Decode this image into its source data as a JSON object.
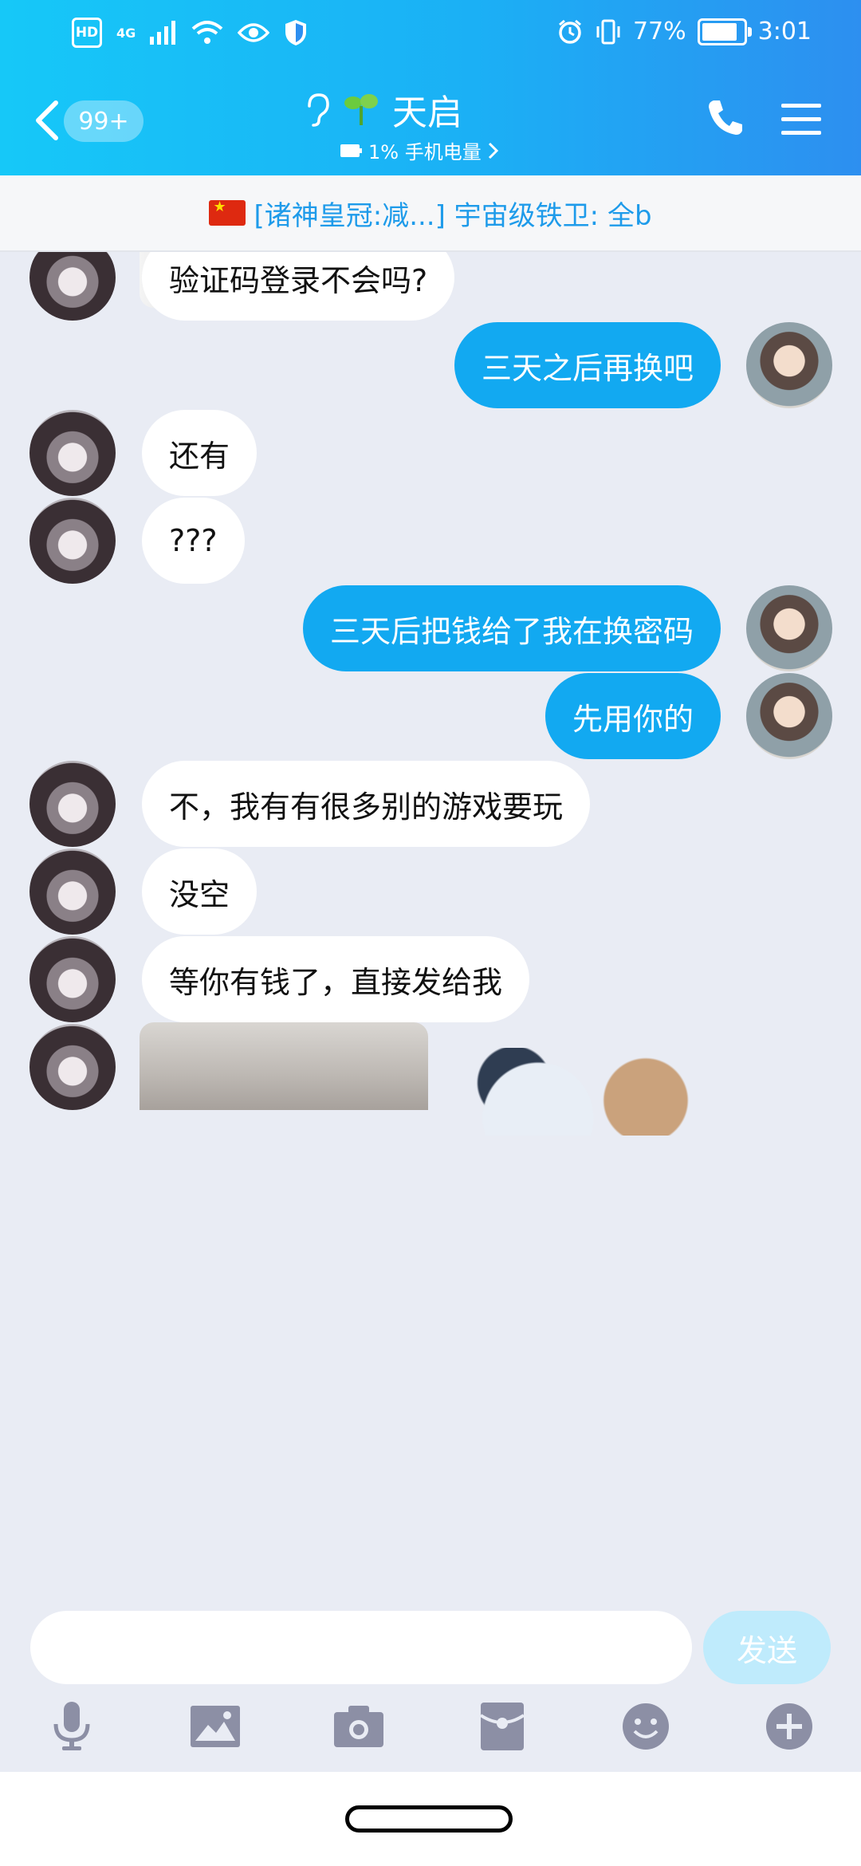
{
  "status_bar": {
    "hd": "HD",
    "network": "4G",
    "battery_text": "77%",
    "battery_level": 0.77,
    "time": "3:01"
  },
  "header": {
    "unread_badge": "99+",
    "title": "天启",
    "subtitle": "1% 手机电量"
  },
  "notice": {
    "text": "[诸神皇冠:减...] 宇宙级铁卫: 全b"
  },
  "messages": [
    {
      "side": "in",
      "text": "验证码登录不会吗?"
    },
    {
      "side": "out",
      "text": "三天之后再换吧"
    },
    {
      "side": "in",
      "text": "还有"
    },
    {
      "side": "in",
      "text": "???"
    },
    {
      "side": "out",
      "text": "三天后把钱给了我在换密码"
    },
    {
      "side": "out",
      "text": "先用你的"
    },
    {
      "side": "in",
      "text": "不，我有有很多别的游戏要玩"
    },
    {
      "side": "in",
      "text": "没空"
    },
    {
      "side": "in",
      "text": "等你有钱了，直接发给我"
    }
  ],
  "composer": {
    "input_value": "",
    "send_label": "发送"
  },
  "colors": {
    "header_start": "#16C8F8",
    "header_end": "#2D8FF0",
    "bubble_out": "#12A9F1",
    "bubble_in": "#FFFFFF",
    "chat_bg": "#E9ECF4",
    "notice_text": "#1E9BEA",
    "toolbar_icon": "#8C8FA5"
  },
  "icons": {
    "toolbar": [
      "microphone-icon",
      "image-icon",
      "camera-icon",
      "red-packet-icon",
      "emoji-icon",
      "plus-icon"
    ]
  }
}
